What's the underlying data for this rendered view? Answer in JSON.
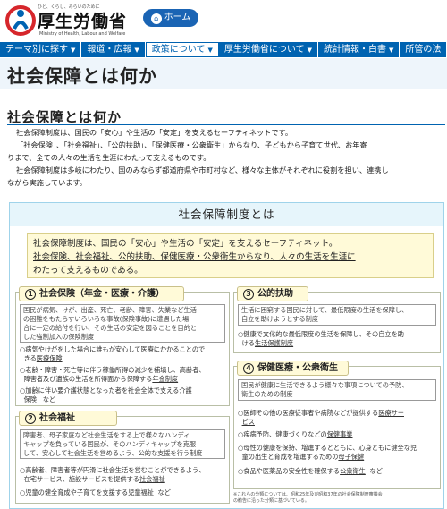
{
  "header": {
    "tagline": "ひと、くらし、みらいのために",
    "logo_text": "厚生労働省",
    "logo_en": "Ministry of Health, Labour and Welfare",
    "home_label": "ホーム",
    "brand_color": "#0063b1"
  },
  "nav": {
    "items": [
      {
        "label": "テーマ別に探す",
        "active": false
      },
      {
        "label": "報道・広報",
        "active": false
      },
      {
        "label": "政策について",
        "active": true
      },
      {
        "label": "厚生労働省について",
        "active": false
      },
      {
        "label": "統計情報・白書",
        "active": false
      },
      {
        "label": "所管の法",
        "active": false
      }
    ]
  },
  "page_title": "社会保障とは何か",
  "section": {
    "title": "社会保障とは何か",
    "paragraphs": [
      "社会保障制度は、国民の「安心」や生活の「安定」を支えるセーフティネットです。",
      "「社会保険」、「社会福祉」、「公的扶助」、「保健医療・公衆衛生」からなり、子どもから子育て世代、お年寄",
      "りまで、全ての人々の生活を生涯にわたって支えるものです。",
      "社会保障制度は多岐にわたり、国のみならず都道府県や市町村など、様々な主体がそれぞれに役割を担い、連携し",
      "ながら実施しています。"
    ]
  },
  "figure": {
    "title": "社会保障制度とは",
    "definition": {
      "line1": "社会保障制度は、国民の「安心」や生活の「安定」を支えるセーフティネット。",
      "line2": "社会保険、社会福祉、公的扶助、保健医療・公衆衛生からなり、人々の生活を生涯に",
      "line3": "わたって支えるものである。"
    },
    "col1": {
      "num": "1",
      "title": "社会保険（年金・医療・介護）",
      "desc1": "国民が病気、けが、出産、死亡、老齢、障害、失業など生活",
      "desc2": "の困難をもたらすいろいろな事故(保険事故)に遭遇した場",
      "desc3": "合に一定の給付を行い、その生活の安定を図ることを目的と",
      "desc4": "した強制加入の保険制度",
      "b1a": "○病気やけがをした場合に誰もが安心して医療にかかることので",
      "b1b": "きる",
      "b1c": "医療保険",
      "b2a": "○老齢・障害・死亡等に伴う稼働所得の減少を補填し、高齢者、",
      "b2b": "障害者及び遺族の生活を所得面から保障する",
      "b2c": "年金制度",
      "b3a": "○加齢に伴い要介護状態となった者を社会全体で支える",
      "b3b": "介護",
      "b3c": "保険",
      "b3d": "など"
    },
    "col2": {
      "num": "2",
      "title": "社会福祉",
      "desc1": "障害者、母子家庭など社会生活をする上で様々なハンディ",
      "desc2": "キャップを負っている国民が、そのハンディキャップを克服",
      "desc3": "して、安心して社会生活を営めるよう、公的な支援を行う制度",
      "b1a": "○高齢者、障害者等が円滑に社会生活を営むことができるよう、",
      "b1b": "在宅サービス、施設サービスを提供する",
      "b1c": "社会福祉",
      "b2a": "○児童の健全育成や子育てを支援する",
      "b2b": "児童福祉",
      "b2c": "など"
    },
    "col3": {
      "num": "3",
      "title": "公的扶助",
      "desc1": "生活に困窮する国民に対して、最低限度の生活を保障し、",
      "desc2": "自立を助けようとする制度",
      "b1a": "○健康で文化的な最低限度の生活を保障し、その自立を助",
      "b1b": "ける",
      "b1c": "生活保護制度"
    },
    "col4": {
      "num": "4",
      "title": "保健医療・公衆衛生",
      "desc1": "国民が健康に生活できるよう様々な事項についての予防、",
      "desc2": "衛生のための制度",
      "b1a": "○医師その他の医療従事者や病院などが提供する",
      "b1b": "医療サー",
      "b1c": "ビス",
      "b2a": "○疾病予防、健康づくりなどの",
      "b2b": "保健事業",
      "b3a": "○母性の健康を保持、増進するとともに、心身ともに健全な児",
      "b3b": "童の出生と育成を増進するための",
      "b3c": "母子保健",
      "b4a": "○食品や医薬品の安全性を確保する",
      "b4b": "公衆衛生",
      "b4c": "など"
    },
    "footnote1": "※これらの分類については、昭和25年及び昭和37年の社会保障制度審議会",
    "footnote2": "の勧告に沿った分類に基づいている。"
  }
}
